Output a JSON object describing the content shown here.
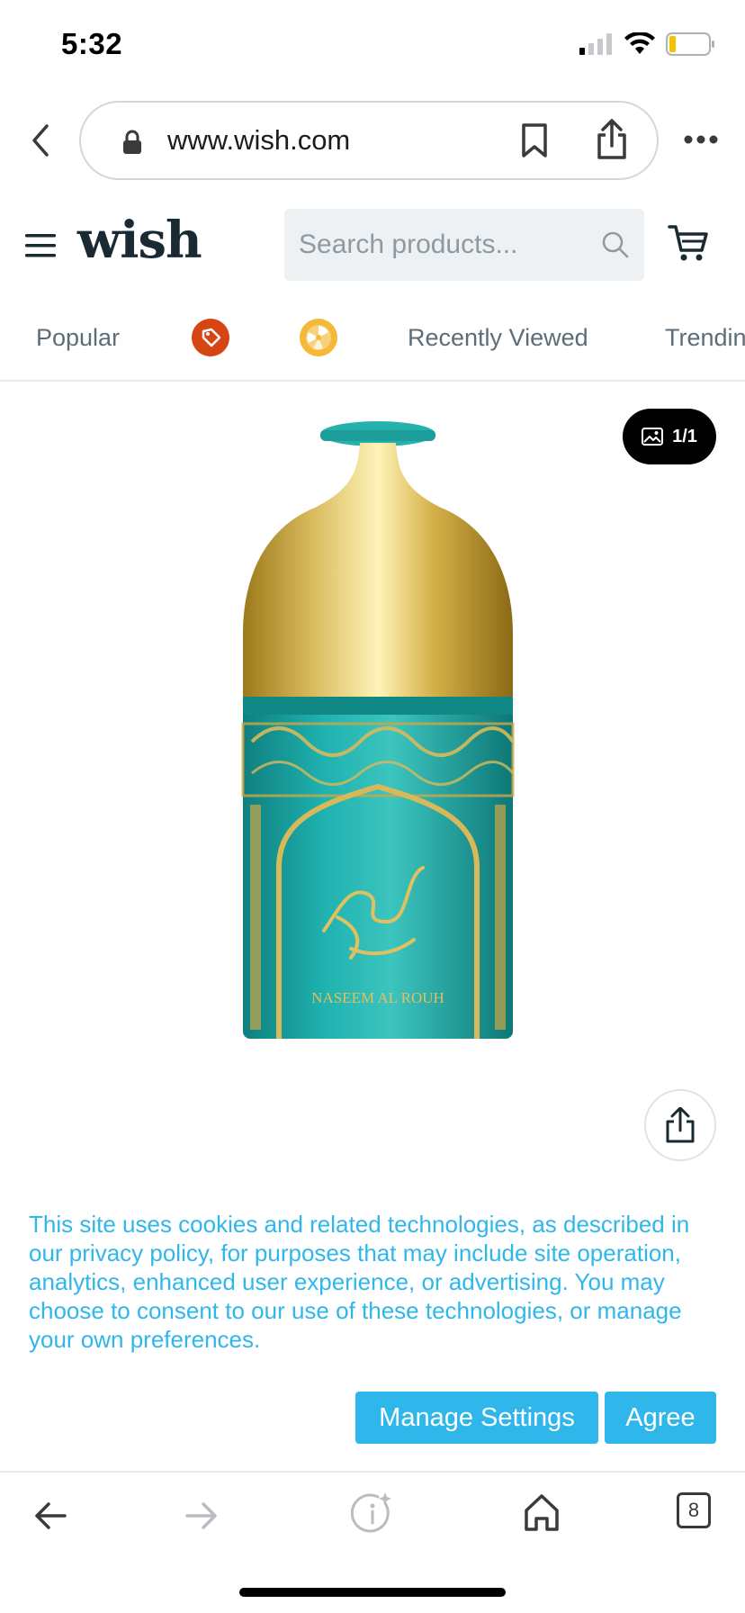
{
  "status_bar": {
    "time": "5:32"
  },
  "browser": {
    "url": "www.wish.com",
    "tab_count": "8"
  },
  "header": {
    "logo": "wish",
    "search_placeholder": "Search products..."
  },
  "tabs": {
    "popular": "Popular",
    "recently_viewed": "Recently Viewed",
    "trending": "Trendin"
  },
  "product": {
    "image_counter": "1/1",
    "label_text": "NASEEM AL ROUH",
    "accent_teal": "#19a7a6",
    "accent_gold": "#d4b24a"
  },
  "cookie": {
    "message": "This site uses cookies and related technologies, as described in our privacy policy, for purposes that may include site operation, analytics, enhanced user experience, or advertising. You may choose to consent to our use of these technologies, or manage your own preferences.",
    "manage_label": "Manage Settings",
    "agree_label": "Agree",
    "accent": "#2fb7ec"
  }
}
